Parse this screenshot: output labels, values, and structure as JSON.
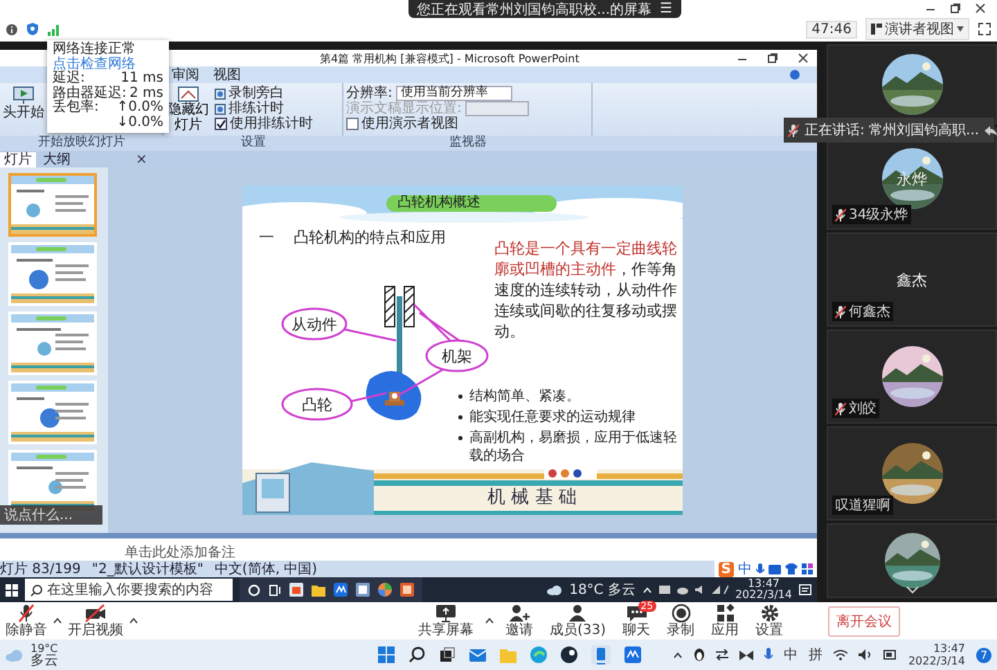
{
  "viewer_banner": {
    "text": "您正在观看常州刘国钧高职校...的屏幕",
    "menu_glyph": "☰"
  },
  "top_bar": {
    "timer": "47:46",
    "view_mode": "演讲者视图"
  },
  "network_popup": {
    "status": "网络连接正常",
    "link": "点击检查网络",
    "stats": [
      {
        "label": "延迟:",
        "values": [
          "11 ms"
        ]
      },
      {
        "label": "路由器延迟:",
        "values": [
          "2 ms"
        ]
      },
      {
        "label": "丢包率:",
        "values": [
          "↑0.0%",
          "↓0.0%"
        ]
      }
    ]
  },
  "powerpoint": {
    "title": "第4篇 常用机构 [兼容模式] - Microsoft PowerPoint",
    "ribbon_tabs": [
      {
        "label": "审阅",
        "selected": false
      },
      {
        "label": "视图",
        "selected": false
      }
    ],
    "start_group": {
      "button": "头开始",
      "label": "开始放映幻灯片"
    },
    "setup_group": {
      "label": "设置",
      "hide_button": "隐藏幻灯片",
      "options": [
        {
          "kind": "button",
          "label": "录制旁白"
        },
        {
          "kind": "button",
          "label": "排练计时"
        },
        {
          "kind": "check",
          "label": "使用排练计时",
          "checked": true
        }
      ]
    },
    "monitor_group": {
      "label": "监视器",
      "resolution_label": "分辨率:",
      "resolution_value": "使用当前分辨率",
      "display_label": "演示文稿显示位置:",
      "display_disabled": true,
      "presenter_view": {
        "label": "使用演示者视图",
        "checked": false
      }
    },
    "pane_tabs": [
      {
        "label": "灯片",
        "selected": true
      },
      {
        "label": "大纲",
        "selected": false
      }
    ],
    "pane_close": "×",
    "thumbnails": [
      {
        "selected": true
      },
      {
        "selected": false
      },
      {
        "selected": false
      },
      {
        "selected": false
      },
      {
        "selected": false
      }
    ],
    "chat_input": {
      "placeholder": "说点什么..."
    },
    "slide": {
      "title": "凸轮机构概述",
      "heading_marker": "一",
      "heading": "凸轮机构的特点和应用",
      "definition_highlight": "凸轮是一个具有一定曲线轮廓或凹槽的主动件",
      "definition_rest": "，作等角速度的连续转动，从动件作连续或间歇的往复移动或摆动。",
      "labels": [
        {
          "kind": "follower",
          "text": "从动件"
        },
        {
          "kind": "frame",
          "text": "机架"
        },
        {
          "kind": "cam",
          "text": "凸轮"
        }
      ],
      "bullets": [
        "结构简单、紧凑。",
        "能实现任意要求的运动规律",
        "高副机构，易磨损，应用于低速轻载的场合"
      ],
      "footer": "机 械 基 础"
    },
    "notes_placeholder": "单击此处添加备注",
    "status_bar": [
      "灯片 83/199",
      "\"2_默认设计模板\"",
      "中文(简体, 中国)"
    ],
    "ime_bar": {
      "logo": "S",
      "mode": "中"
    },
    "remote_taskbar": {
      "search_placeholder": "在这里输入你要搜索的内容",
      "weather": "18°C 多云",
      "time": "13:47",
      "date": "2022/3/14"
    }
  },
  "speaking_notice": "正在讲话: 常州刘国钧高职...",
  "participants": [
    {
      "kind": "picture"
    },
    {
      "kind": "picture",
      "overlay": "永烨",
      "name": "34级永烨",
      "muted": true
    },
    {
      "kind": "text",
      "overlay": "鑫杰",
      "name": "何鑫杰",
      "muted": true
    },
    {
      "kind": "picture",
      "name": "刘皎",
      "muted": true
    },
    {
      "kind": "picture",
      "name": "叹道猩啊",
      "muted": false
    },
    {
      "kind": "picture"
    }
  ],
  "meeting_toolbar": {
    "left": [
      {
        "kind": "mic",
        "label": "除静音"
      },
      {
        "kind": "camera",
        "label": "开启视频"
      }
    ],
    "center": [
      {
        "kind": "share",
        "label": "共享屏幕"
      },
      {
        "kind": "invite",
        "label": "邀请"
      },
      {
        "kind": "members",
        "label": "成员(33)"
      },
      {
        "kind": "chat",
        "label": "聊天",
        "badge": "25"
      },
      {
        "kind": "record",
        "label": "录制"
      },
      {
        "kind": "apps",
        "label": "应用"
      },
      {
        "kind": "settings",
        "label": "设置"
      }
    ],
    "leave": "离开会议"
  },
  "win_taskbar": {
    "temp": "19°C",
    "weather": "多云",
    "tray": [
      "中",
      "拼"
    ],
    "time": "13:47",
    "date": "2022/3/14",
    "notifications": "7"
  }
}
